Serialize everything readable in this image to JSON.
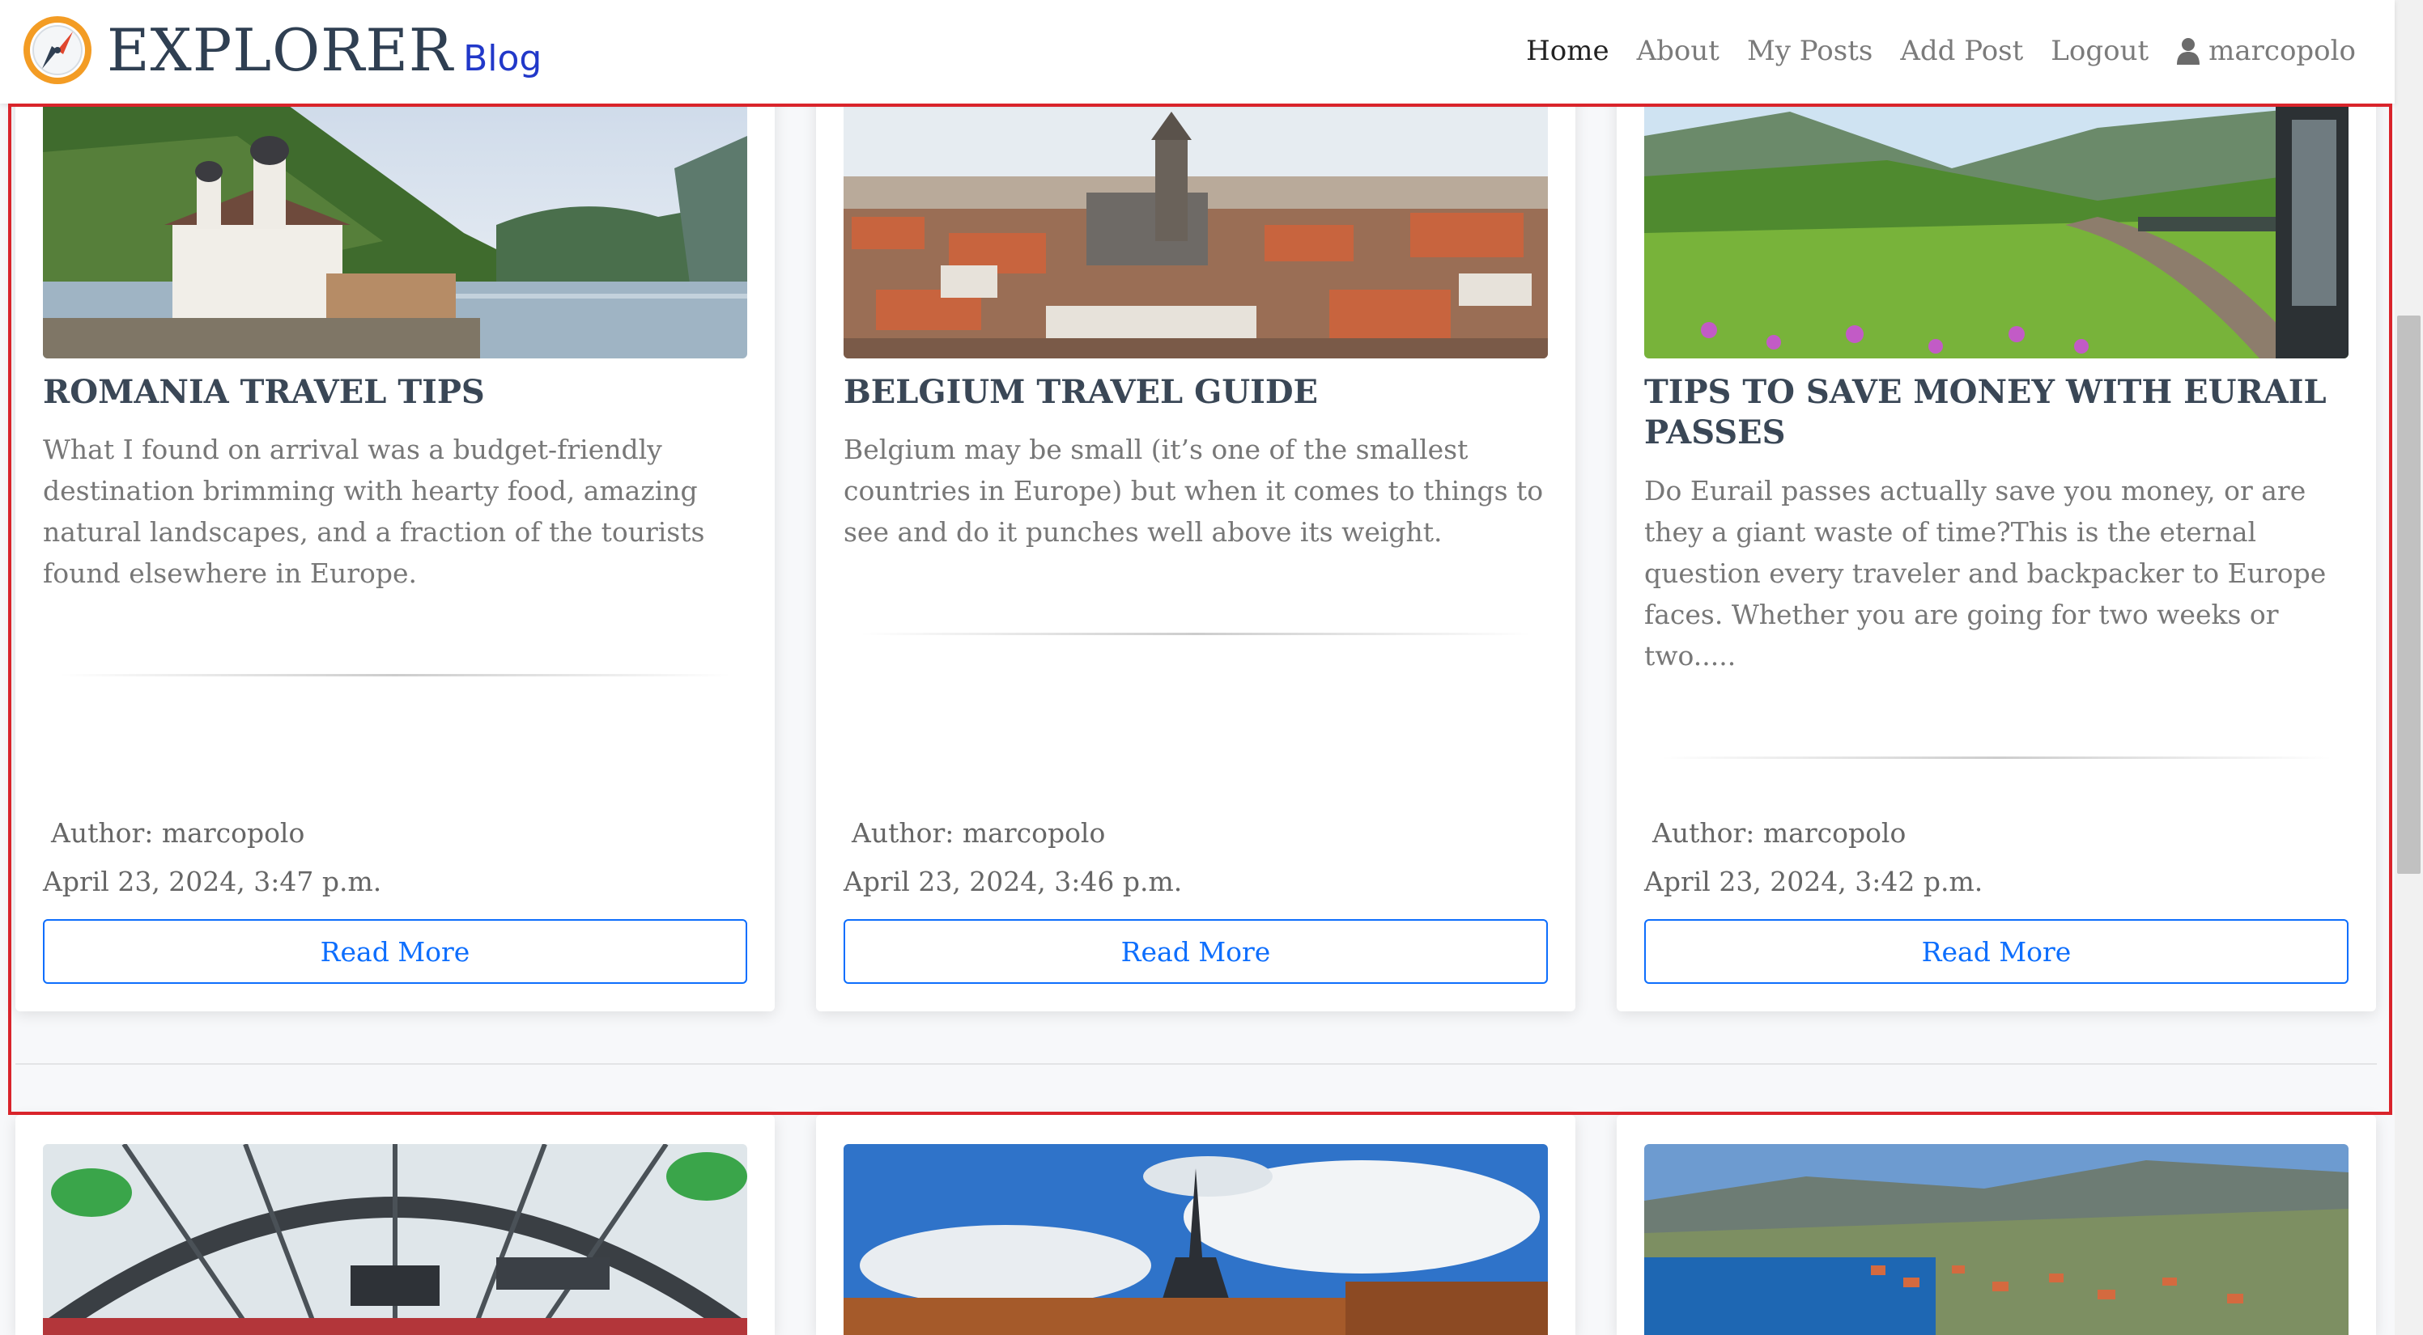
{
  "brand": {
    "title": "EXPLORER",
    "subtitle": "Blog",
    "logo_icon": "compass-icon"
  },
  "nav": {
    "items": [
      {
        "label": "Home",
        "active": true
      },
      {
        "label": "About"
      },
      {
        "label": "My Posts"
      },
      {
        "label": "Add Post"
      },
      {
        "label": "Logout"
      }
    ],
    "user": {
      "icon": "user-icon",
      "name": "marcopolo"
    }
  },
  "posts": [
    {
      "title": "ROMANIA TRAVEL TIPS",
      "excerpt": "What I found on arrival was a budget-friendly destination brimming with hearty food, amazing natural landscapes, and a fraction of the tourists found elsewhere in Europe.",
      "author": "Author: marcopolo",
      "date": "April 23, 2024, 3:47 p.m.",
      "button": "Read More",
      "image": "monastery-by-river-photo"
    },
    {
      "title": "BELGIUM TRAVEL GUIDE",
      "excerpt": "Belgium may be small (it’s one of the smallest countries in Europe) but when it comes to things to see and do it punches well above its weight.",
      "author": "Author: marcopolo",
      "date": "April 23, 2024, 3:46 p.m.",
      "button": "Read More",
      "image": "city-skyline-photo"
    },
    {
      "title": "TIPS TO SAVE MONEY WITH EURAIL PASSES",
      "excerpt": "Do Eurail passes actually save you money, or are they a giant waste of time?This is the eternal question every traveler and backpacker to Europe faces. Whether you are going for two weeks or two.....",
      "author": "Author: marcopolo",
      "date": "April 23, 2024, 3:42 p.m.",
      "button": "Read More",
      "image": "train-valley-photo"
    }
  ],
  "next_row_images": [
    "train-station-photo",
    "eiffel-tower-photo",
    "coastal-town-photo"
  ],
  "colors": {
    "accent": "#0d6efd",
    "brand_sub": "#2138c9",
    "highlight": "#d9242b",
    "title": "#3a4756"
  }
}
